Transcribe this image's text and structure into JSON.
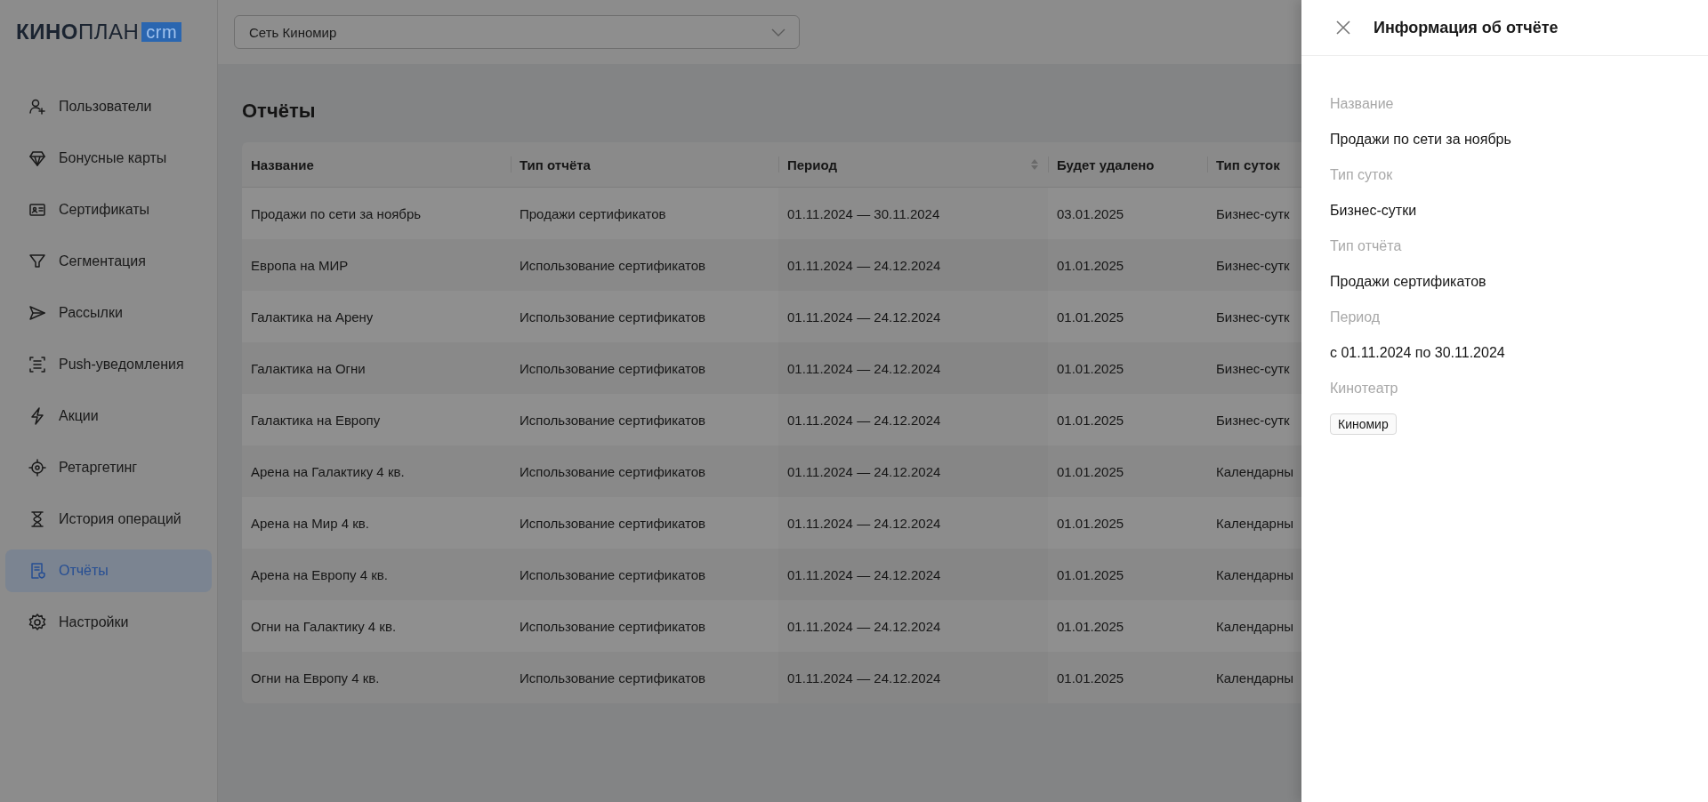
{
  "logo": {
    "bold": "КИНО",
    "light": "ПЛАН",
    "badge": "crm"
  },
  "network_select": {
    "value": "Сеть Киномир"
  },
  "sidebar": {
    "items": [
      {
        "label": "Пользователи",
        "selected": false
      },
      {
        "label": "Бонусные карты",
        "selected": false
      },
      {
        "label": "Сертификаты",
        "selected": false
      },
      {
        "label": "Сегментация",
        "selected": false
      },
      {
        "label": "Рассылки",
        "selected": false
      },
      {
        "label": "Push-уведомления",
        "selected": false
      },
      {
        "label": "Акции",
        "selected": false
      },
      {
        "label": "Ретаргетинг",
        "selected": false
      },
      {
        "label": "История операций",
        "selected": false
      },
      {
        "label": "Отчёты",
        "selected": true
      },
      {
        "label": "Настройки",
        "selected": false
      }
    ]
  },
  "page_title": "Отчёты",
  "table": {
    "columns": [
      {
        "label": "Название",
        "sortable": false
      },
      {
        "label": "Тип отчёта",
        "sortable": false
      },
      {
        "label": "Период",
        "sortable": true
      },
      {
        "label": "Будет удалено",
        "sortable": false
      },
      {
        "label": "Тип суток",
        "sortable": false
      }
    ],
    "rows": [
      [
        "Продажи по сети за ноябрь",
        "Продажи сертификатов",
        "01.11.2024 — 30.11.2024",
        "03.01.2025",
        "Бизнес-сутк"
      ],
      [
        "Европа на МИР",
        "Использование сертификатов",
        "01.11.2024 — 24.12.2024",
        "01.01.2025",
        "Бизнес-сутк"
      ],
      [
        "Галактика на Арену",
        "Использование сертификатов",
        "01.11.2024 — 24.12.2024",
        "01.01.2025",
        "Бизнес-сутк"
      ],
      [
        "Галактика на Огни",
        "Использование сертификатов",
        "01.11.2024 — 24.12.2024",
        "01.01.2025",
        "Бизнес-сутк"
      ],
      [
        "Галактика на Европу",
        "Использование сертификатов",
        "01.11.2024 — 24.12.2024",
        "01.01.2025",
        "Бизнес-сутк"
      ],
      [
        "Арена на Галактику 4 кв.",
        "Использование сертификатов",
        "01.11.2024 — 24.12.2024",
        "01.01.2025",
        "Календарны"
      ],
      [
        "Арена на Мир 4 кв.",
        "Использование сертификатов",
        "01.11.2024 — 24.12.2024",
        "01.01.2025",
        "Календарны"
      ],
      [
        "Арена на Европу 4 кв.",
        "Использование сертификатов",
        "01.11.2024 — 24.12.2024",
        "01.01.2025",
        "Календарны"
      ],
      [
        "Огни на Галактику 4 кв.",
        "Использование сертификатов",
        "01.11.2024 — 24.12.2024",
        "01.01.2025",
        "Календарны"
      ],
      [
        "Огни на Европу 4 кв.",
        "Использование сертификатов",
        "01.11.2024 — 24.12.2024",
        "01.01.2025",
        "Календарны"
      ]
    ]
  },
  "panel": {
    "title": "Информация об отчёте",
    "fields": [
      {
        "label": "Название",
        "kind": "text",
        "value": "Продажи по сети за ноябрь"
      },
      {
        "label": "Тип суток",
        "kind": "text",
        "value": "Бизнес-сутки"
      },
      {
        "label": "Тип отчёта",
        "kind": "text",
        "value": "Продажи сертификатов"
      },
      {
        "label": "Период",
        "kind": "text",
        "value": "с 01.11.2024 по 30.11.2024"
      },
      {
        "label": "Кинотеатр",
        "kind": "tag",
        "value": "Киномир"
      }
    ]
  }
}
